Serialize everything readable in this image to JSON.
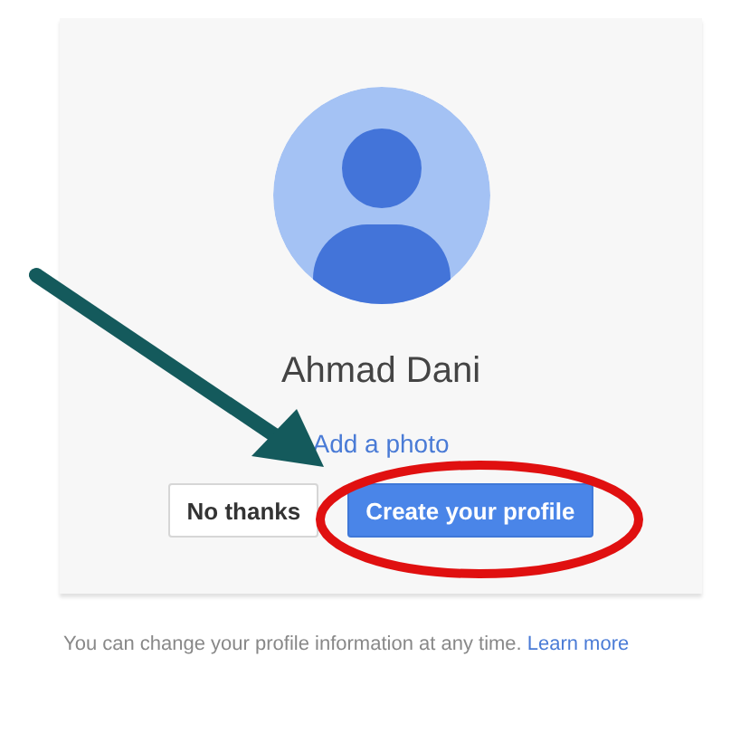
{
  "profile": {
    "name": "Ahmad Dani",
    "add_photo_link": "Add a photo"
  },
  "buttons": [
    {
      "label": "No thanks",
      "kind": "secondary"
    },
    {
      "label": "Create your profile",
      "kind": "primary"
    }
  ],
  "footer": {
    "text": "You can change your profile information at any time.",
    "link": "Learn more"
  }
}
